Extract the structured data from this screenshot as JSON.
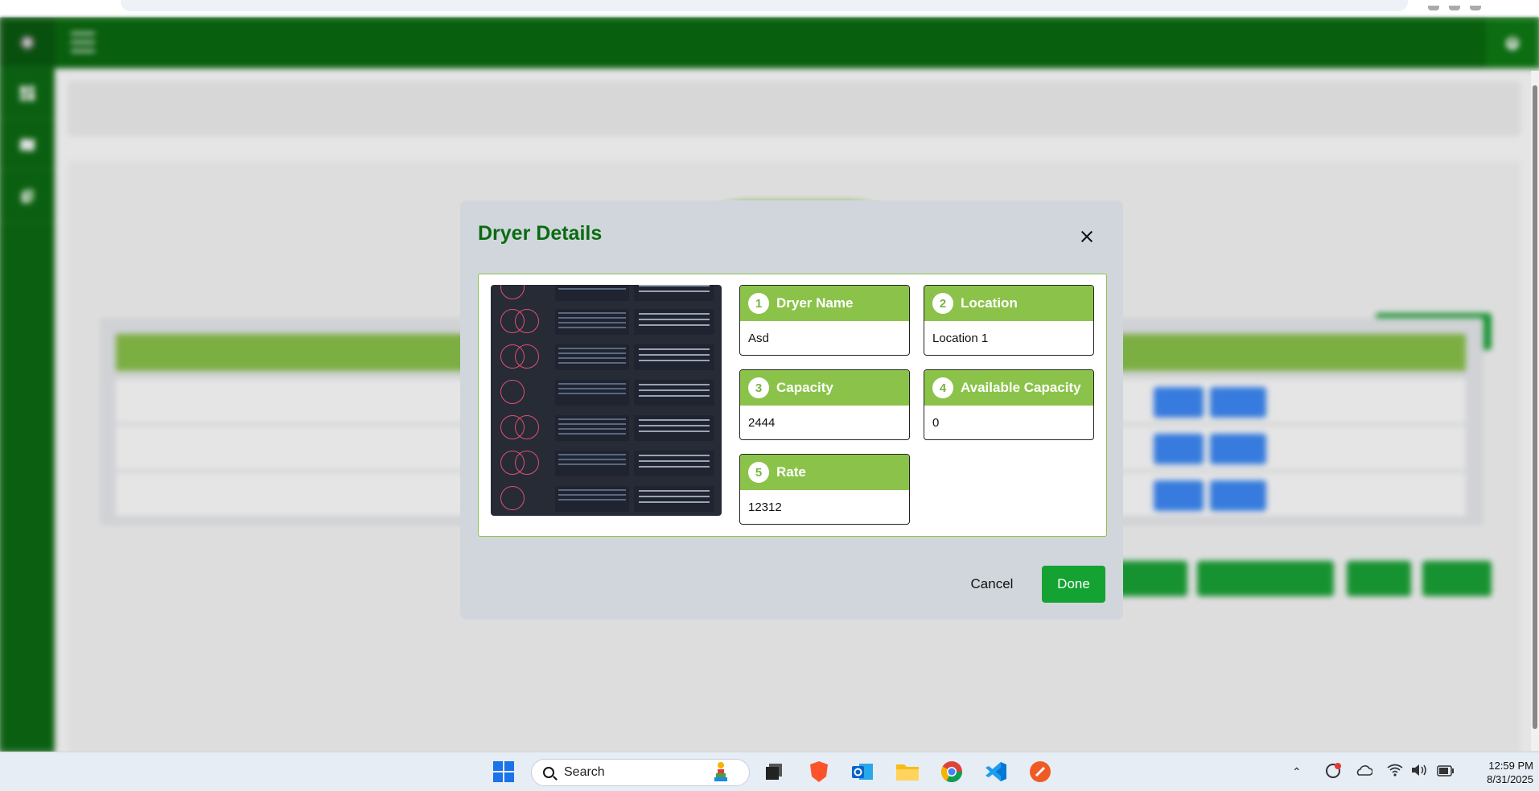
{
  "modal": {
    "title": "Dryer Details",
    "fields": [
      {
        "num": "1",
        "label": "Dryer Name",
        "value": "Asd"
      },
      {
        "num": "2",
        "label": "Location",
        "value": "Location 1"
      },
      {
        "num": "3",
        "label": "Capacity",
        "value": "2444"
      },
      {
        "num": "4",
        "label": "Available Capacity",
        "value": "0"
      },
      {
        "num": "5",
        "label": "Rate",
        "value": "12312"
      }
    ],
    "cancel_label": "Cancel",
    "done_label": "Done"
  },
  "colors": {
    "primary_green": "#0a6a0f",
    "accent_green": "#8bc34a",
    "button_green": "#14a332",
    "modal_bg": "#d1d6dc"
  },
  "taskbar": {
    "search_placeholder": "Search",
    "time": "12:59 PM",
    "date": "8/31/2025"
  },
  "icons": {
    "sidebar": [
      "dashboard-icon",
      "map-icon",
      "documents-icon"
    ],
    "header": [
      "hamburger-menu-icon",
      "user-icon"
    ]
  }
}
